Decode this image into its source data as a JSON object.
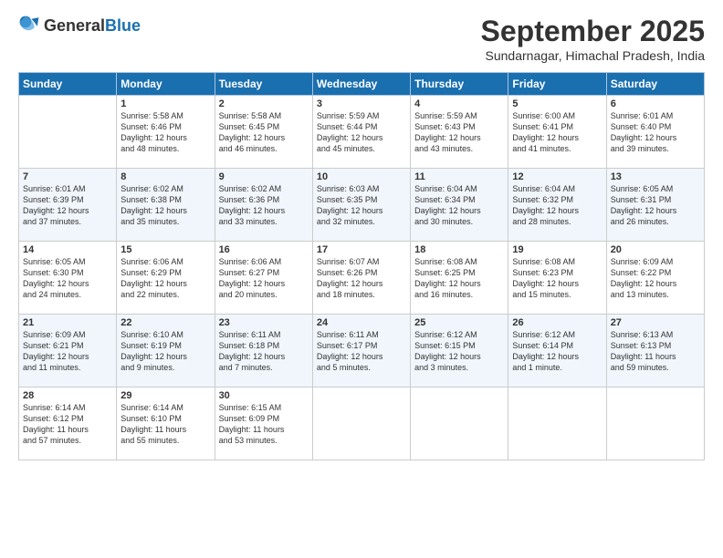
{
  "logo": {
    "general": "General",
    "blue": "Blue"
  },
  "header": {
    "month": "September 2025",
    "location": "Sundarnagar, Himachal Pradesh, India"
  },
  "days_of_week": [
    "Sunday",
    "Monday",
    "Tuesday",
    "Wednesday",
    "Thursday",
    "Friday",
    "Saturday"
  ],
  "weeks": [
    [
      {
        "day": "",
        "info": ""
      },
      {
        "day": "1",
        "info": "Sunrise: 5:58 AM\nSunset: 6:46 PM\nDaylight: 12 hours\nand 48 minutes."
      },
      {
        "day": "2",
        "info": "Sunrise: 5:58 AM\nSunset: 6:45 PM\nDaylight: 12 hours\nand 46 minutes."
      },
      {
        "day": "3",
        "info": "Sunrise: 5:59 AM\nSunset: 6:44 PM\nDaylight: 12 hours\nand 45 minutes."
      },
      {
        "day": "4",
        "info": "Sunrise: 5:59 AM\nSunset: 6:43 PM\nDaylight: 12 hours\nand 43 minutes."
      },
      {
        "day": "5",
        "info": "Sunrise: 6:00 AM\nSunset: 6:41 PM\nDaylight: 12 hours\nand 41 minutes."
      },
      {
        "day": "6",
        "info": "Sunrise: 6:01 AM\nSunset: 6:40 PM\nDaylight: 12 hours\nand 39 minutes."
      }
    ],
    [
      {
        "day": "7",
        "info": "Sunrise: 6:01 AM\nSunset: 6:39 PM\nDaylight: 12 hours\nand 37 minutes."
      },
      {
        "day": "8",
        "info": "Sunrise: 6:02 AM\nSunset: 6:38 PM\nDaylight: 12 hours\nand 35 minutes."
      },
      {
        "day": "9",
        "info": "Sunrise: 6:02 AM\nSunset: 6:36 PM\nDaylight: 12 hours\nand 33 minutes."
      },
      {
        "day": "10",
        "info": "Sunrise: 6:03 AM\nSunset: 6:35 PM\nDaylight: 12 hours\nand 32 minutes."
      },
      {
        "day": "11",
        "info": "Sunrise: 6:04 AM\nSunset: 6:34 PM\nDaylight: 12 hours\nand 30 minutes."
      },
      {
        "day": "12",
        "info": "Sunrise: 6:04 AM\nSunset: 6:32 PM\nDaylight: 12 hours\nand 28 minutes."
      },
      {
        "day": "13",
        "info": "Sunrise: 6:05 AM\nSunset: 6:31 PM\nDaylight: 12 hours\nand 26 minutes."
      }
    ],
    [
      {
        "day": "14",
        "info": "Sunrise: 6:05 AM\nSunset: 6:30 PM\nDaylight: 12 hours\nand 24 minutes."
      },
      {
        "day": "15",
        "info": "Sunrise: 6:06 AM\nSunset: 6:29 PM\nDaylight: 12 hours\nand 22 minutes."
      },
      {
        "day": "16",
        "info": "Sunrise: 6:06 AM\nSunset: 6:27 PM\nDaylight: 12 hours\nand 20 minutes."
      },
      {
        "day": "17",
        "info": "Sunrise: 6:07 AM\nSunset: 6:26 PM\nDaylight: 12 hours\nand 18 minutes."
      },
      {
        "day": "18",
        "info": "Sunrise: 6:08 AM\nSunset: 6:25 PM\nDaylight: 12 hours\nand 16 minutes."
      },
      {
        "day": "19",
        "info": "Sunrise: 6:08 AM\nSunset: 6:23 PM\nDaylight: 12 hours\nand 15 minutes."
      },
      {
        "day": "20",
        "info": "Sunrise: 6:09 AM\nSunset: 6:22 PM\nDaylight: 12 hours\nand 13 minutes."
      }
    ],
    [
      {
        "day": "21",
        "info": "Sunrise: 6:09 AM\nSunset: 6:21 PM\nDaylight: 12 hours\nand 11 minutes."
      },
      {
        "day": "22",
        "info": "Sunrise: 6:10 AM\nSunset: 6:19 PM\nDaylight: 12 hours\nand 9 minutes."
      },
      {
        "day": "23",
        "info": "Sunrise: 6:11 AM\nSunset: 6:18 PM\nDaylight: 12 hours\nand 7 minutes."
      },
      {
        "day": "24",
        "info": "Sunrise: 6:11 AM\nSunset: 6:17 PM\nDaylight: 12 hours\nand 5 minutes."
      },
      {
        "day": "25",
        "info": "Sunrise: 6:12 AM\nSunset: 6:15 PM\nDaylight: 12 hours\nand 3 minutes."
      },
      {
        "day": "26",
        "info": "Sunrise: 6:12 AM\nSunset: 6:14 PM\nDaylight: 12 hours\nand 1 minute."
      },
      {
        "day": "27",
        "info": "Sunrise: 6:13 AM\nSunset: 6:13 PM\nDaylight: 11 hours\nand 59 minutes."
      }
    ],
    [
      {
        "day": "28",
        "info": "Sunrise: 6:14 AM\nSunset: 6:12 PM\nDaylight: 11 hours\nand 57 minutes."
      },
      {
        "day": "29",
        "info": "Sunrise: 6:14 AM\nSunset: 6:10 PM\nDaylight: 11 hours\nand 55 minutes."
      },
      {
        "day": "30",
        "info": "Sunrise: 6:15 AM\nSunset: 6:09 PM\nDaylight: 11 hours\nand 53 minutes."
      },
      {
        "day": "",
        "info": ""
      },
      {
        "day": "",
        "info": ""
      },
      {
        "day": "",
        "info": ""
      },
      {
        "day": "",
        "info": ""
      }
    ]
  ]
}
